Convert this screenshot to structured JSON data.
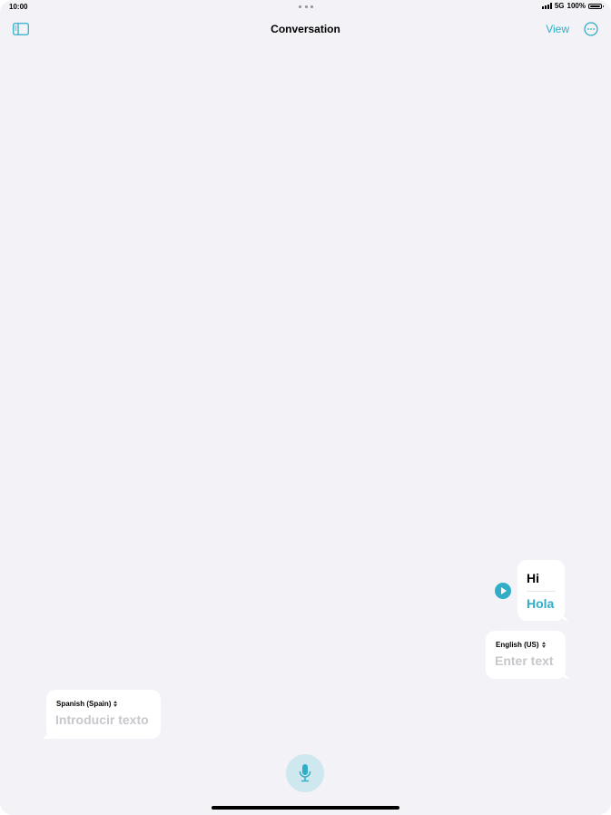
{
  "status_bar": {
    "time": "10:00",
    "network": "5G",
    "battery": "100%"
  },
  "nav": {
    "title": "Conversation",
    "view_label": "View"
  },
  "conversation": {
    "messages": [
      {
        "source": "Hi",
        "translation": "Hola"
      }
    ]
  },
  "inputs": {
    "english": {
      "language": "English (US)",
      "placeholder": "Enter text"
    },
    "spanish": {
      "language": "Spanish (Spain)",
      "placeholder": "Introducir texto"
    }
  },
  "colors": {
    "accent": "#30aec8",
    "background": "#f2f2f7",
    "bubble": "#ffffff",
    "placeholder": "#c7c7cc",
    "mic_background": "#cfe7ee"
  },
  "icons": {
    "sidebar": "sidebar-icon",
    "more": "ellipsis-circle-icon",
    "play": "play-icon",
    "mic": "microphone-icon",
    "language_menu": "chevron-up-down-icon"
  }
}
